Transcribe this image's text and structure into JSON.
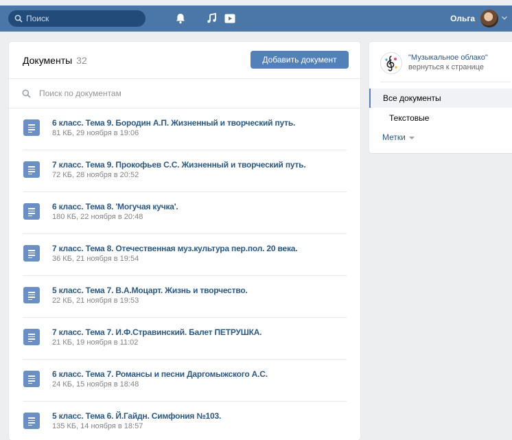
{
  "header": {
    "search_placeholder": "Поиск",
    "user_name": "Ольга",
    "icons": [
      "search-icon",
      "bell-icon",
      "music-icon",
      "video-play-icon",
      "chevron-down-icon"
    ],
    "accent_color": "#4a76a8"
  },
  "main": {
    "title": "Документы",
    "count": "32",
    "add_button_label": "Добавить документ",
    "search_placeholder": "Поиск по документам",
    "documents": [
      {
        "title": "6 класс. Тема 9. Бородин А.П. Жизненный и творческий путь.",
        "meta": "81 КБ, 29 ноября в 19:06"
      },
      {
        "title": "7 класс. Тема 9. Прокофьев С.С. Жизненный и творческий путь.",
        "meta": "72 КБ, 28 ноября в 20:52"
      },
      {
        "title": "6 класс. Тема 8. 'Могучая кучка'.",
        "meta": "180 КБ, 22 ноября в 20:48"
      },
      {
        "title": "7 класс. Тема 8. Отечественная муз.культура пер.пол. 20 века.",
        "meta": "36 КБ, 21 ноября в 19:54"
      },
      {
        "title": "5 класс. Тема 7. В.А.Моцарт. Жизнь и творчество.",
        "meta": "22 КБ, 21 ноября в 19:53"
      },
      {
        "title": "7 класс. Тема 7. И.Ф.Стравинский. Балет ПЕТРУШКА.",
        "meta": "21 КБ, 19 ноября в 11:02"
      },
      {
        "title": "6 класс. Тема 7. Романсы и песни Даргомыжского А.С.",
        "meta": "24 КБ, 15 ноября в 18:48"
      },
      {
        "title": "5 класс. Тема 6. Й.Гайдн. Симфония №103.",
        "meta": "135 КБ, 14 ноября в 18:57"
      }
    ]
  },
  "side": {
    "group_name": "\"Музыкальное облако\"",
    "back_link": "вернуться к странице",
    "nav_all": "Все документы",
    "nav_text": "Текстовые",
    "nav_tags": "Метки"
  }
}
